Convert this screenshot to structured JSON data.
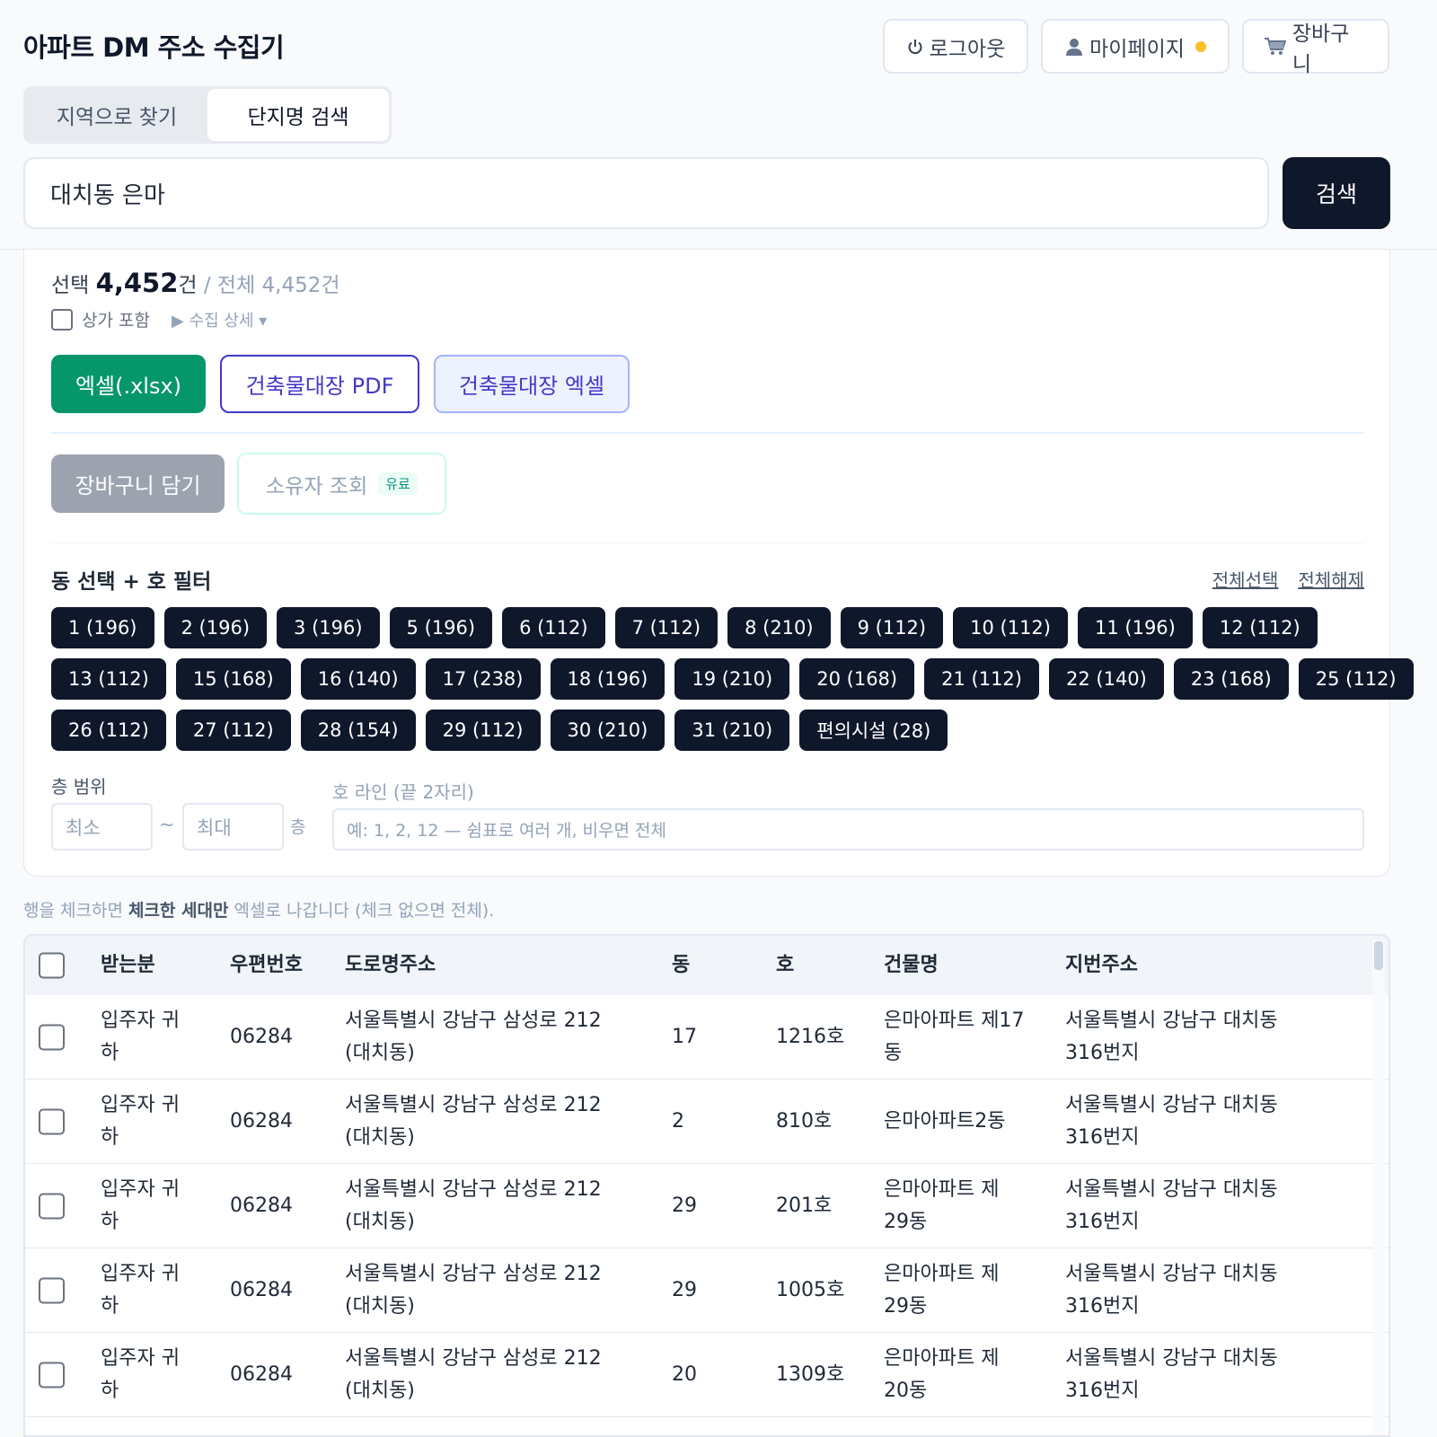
{
  "app": {
    "title": "아파트 DM 주소 수집기"
  },
  "topbar": {
    "logout_icon": "power-icon",
    "logout_label": "로그아웃",
    "mypage_icon": "user-icon",
    "mypage_label": "마이페이지",
    "notification_color": "#fbbf24",
    "cart_icon": "cart-icon",
    "cart_label": "장바구니"
  },
  "tabs": [
    {
      "label": "지역으로 찾기",
      "active": false
    },
    {
      "label": "단지명 검색",
      "active": true
    }
  ],
  "search": {
    "value": "대치동 은마",
    "button_label": "검색"
  },
  "summary": {
    "prefix": "선택",
    "selected_count": "4,452",
    "unit": "건",
    "total_text": "/ 전체 4,452건"
  },
  "options": {
    "include_shops_label": "상가 포함",
    "include_shops_checked": false,
    "detail_label": "▶ 수집 상세 ▾"
  },
  "actions": {
    "excel_label": "엑셀(.xlsx)",
    "pdf_label": "건축물대장 PDF",
    "building_excel_label": "건축물대장 엑셀",
    "cart_label": "장바구니 담기",
    "owner_label": "소유자 조회",
    "owner_badge": "유료"
  },
  "dong_filter": {
    "title": "동 선택 + 호 필터",
    "select_all": "전체선택",
    "deselect_all": "전체해제",
    "rows": [
      [
        "1 (196)",
        "2 (196)",
        "3 (196)",
        "5 (196)",
        "6 (112)",
        "7 (112)",
        "8 (210)",
        "9 (112)",
        "10 (112)",
        "11 (196)",
        "12 (112)"
      ],
      [
        "13 (112)",
        "15 (168)",
        "16 (140)",
        "17 (238)",
        "18 (196)",
        "19 (210)",
        "20 (168)",
        "21 (112)",
        "22 (140)",
        "23 (168)",
        "25 (112)"
      ],
      [
        "26 (112)",
        "27 (112)",
        "28 (154)",
        "29 (112)",
        "30 (210)",
        "31 (210)",
        "편의시설 (28)"
      ]
    ]
  },
  "floor": {
    "label": "층 범위",
    "min_placeholder": "최소",
    "tilde": "~",
    "max_placeholder": "최대",
    "unit": "층"
  },
  "ho_line": {
    "label": "호 라인 (끝 2자리)",
    "placeholder": "예: 1, 2, 12 — 쉼표로 여러 개, 비우면 전체"
  },
  "hint": {
    "before": "행을 체크하면 ",
    "bold": "체크한 세대만",
    "after": " 엑셀로 나갑니다 (체크 없으면 전체)."
  },
  "table": {
    "headers": {
      "recipient": "받는분",
      "zipcode": "우편번호",
      "road_address": "도로명주소",
      "dong": "동",
      "ho": "호",
      "building": "건물명",
      "jibun": "지번주소"
    },
    "rows": [
      {
        "recipient": [
          "입주자 귀",
          "하"
        ],
        "zipcode": "06284",
        "road": [
          "서울특별시 강남구 삼성로 212",
          "(대치동)"
        ],
        "dong": "17",
        "ho": "1216호",
        "building": [
          "은마아파트 제17",
          "동"
        ],
        "jibun": [
          "서울특별시 강남구 대치동",
          "316번지"
        ]
      },
      {
        "recipient": [
          "입주자 귀",
          "하"
        ],
        "zipcode": "06284",
        "road": [
          "서울특별시 강남구 삼성로 212",
          "(대치동)"
        ],
        "dong": "2",
        "ho": "810호",
        "building": [
          "은마아파트2동",
          ""
        ],
        "jibun": [
          "서울특별시 강남구 대치동",
          "316번지"
        ]
      },
      {
        "recipient": [
          "입주자 귀",
          "하"
        ],
        "zipcode": "06284",
        "road": [
          "서울특별시 강남구 삼성로 212",
          "(대치동)"
        ],
        "dong": "29",
        "ho": "201호",
        "building": [
          "은마아파트 제",
          "29동"
        ],
        "jibun": [
          "서울특별시 강남구 대치동",
          "316번지"
        ]
      },
      {
        "recipient": [
          "입주자 귀",
          "하"
        ],
        "zipcode": "06284",
        "road": [
          "서울특별시 강남구 삼성로 212",
          "(대치동)"
        ],
        "dong": "29",
        "ho": "1005호",
        "building": [
          "은마아파트 제",
          "29동"
        ],
        "jibun": [
          "서울특별시 강남구 대치동",
          "316번지"
        ]
      },
      {
        "recipient": [
          "입주자 귀",
          "하"
        ],
        "zipcode": "06284",
        "road": [
          "서울특별시 강남구 삼성로 212",
          "(대치동)"
        ],
        "dong": "20",
        "ho": "1309호",
        "building": [
          "은마아파트 제",
          "20동"
        ],
        "jibun": [
          "서울특별시 강남구 대치동",
          "316번지"
        ]
      }
    ]
  }
}
